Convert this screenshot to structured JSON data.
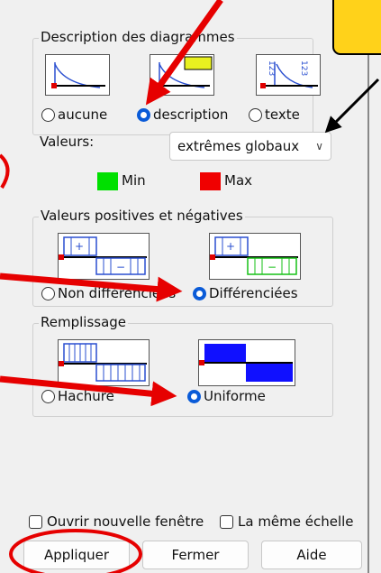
{
  "description_group": {
    "title": "Description des diagrammes",
    "radios": [
      "aucune",
      "description",
      "texte"
    ],
    "selected": "description",
    "icon_labels": [
      "123",
      "123"
    ]
  },
  "valeurs": {
    "label": "Valeurs:",
    "selected": "extrêmes globaux",
    "min_label": "Min",
    "max_label": "Max",
    "min_color": "#00e000",
    "max_color": "#f00000"
  },
  "pos_neg_group": {
    "title": "Valeurs positives et négatives",
    "radios": [
      "Non différenciées",
      "Différenciées"
    ],
    "selected": "Différenciées"
  },
  "remplissage_group": {
    "title": "Remplissage",
    "radios": [
      "Hachuré",
      "Uniforme"
    ],
    "selected": "Uniforme"
  },
  "options": {
    "new_window": "Ouvrir nouvelle fenêtre",
    "same_scale": "La même échelle"
  },
  "buttons": {
    "apply": "Appliquer",
    "close": "Fermer",
    "help": "Aide"
  },
  "colors": {
    "accent": "#0a5bd8",
    "annotation_red": "#e60000",
    "callout_yellow": "#ffd21a"
  }
}
